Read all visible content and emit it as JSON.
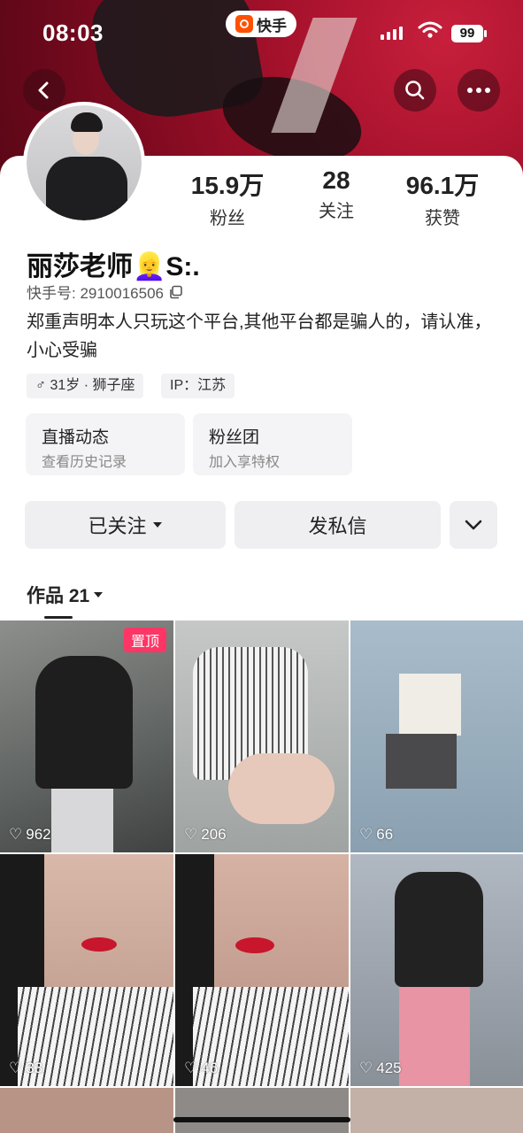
{
  "status_bar": {
    "time": "08:03",
    "app_pill": "快手",
    "battery": "99"
  },
  "profile": {
    "name": "丽莎老师👱‍♀️S:.",
    "kuaishou_id": "快手号: 2910016506",
    "bio": "郑重声明本人只玩这个平台,其他平台都是骗人的，请认准，小心受骗",
    "tags": [
      "♂ 31岁 · 狮子座",
      "IP：江苏"
    ]
  },
  "stats": [
    {
      "value": "15.9万",
      "label": "粉丝"
    },
    {
      "value": "28",
      "label": "关注"
    },
    {
      "value": "96.1万",
      "label": "获赞"
    }
  ],
  "features": [
    {
      "title": "直播动态",
      "subtitle": "查看历史记录"
    },
    {
      "title": "粉丝团",
      "subtitle": "加入享特权"
    }
  ],
  "actions": {
    "follow": "已关注",
    "message": "发私信"
  },
  "works": {
    "tab_label": "作品 21"
  },
  "videos": [
    {
      "likes": "962",
      "pinned": "置顶",
      "bg": "#6b6f6e"
    },
    {
      "likes": "206",
      "bg": "#b4b8b6"
    },
    {
      "likes": "66",
      "bg": "#9fb3c2"
    },
    {
      "likes": "33",
      "bg": "#caa99b"
    },
    {
      "likes": "46",
      "bg": "#c9a497"
    },
    {
      "likes": "425",
      "bg": "#8b8f94"
    }
  ],
  "colors": {
    "accent": "#fe3666",
    "banner": "#a5112b"
  }
}
